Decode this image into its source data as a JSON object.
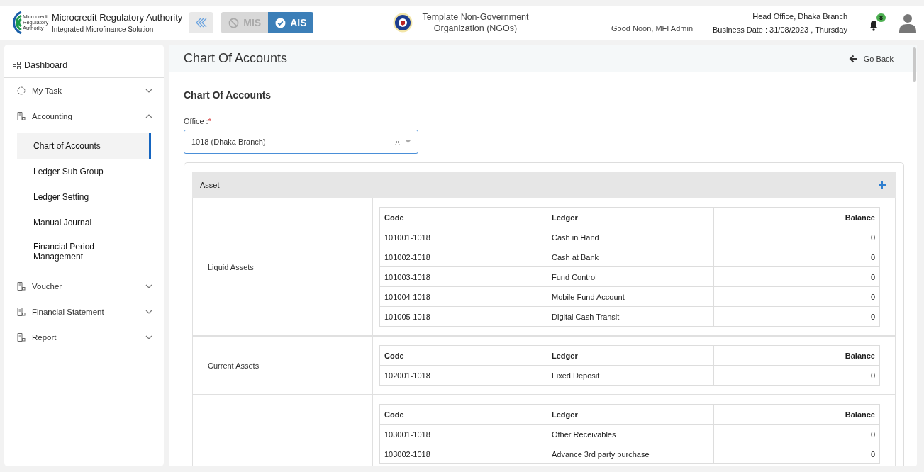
{
  "header": {
    "logo_text": "Microcredit Regulatory Authority",
    "org_name": "Microcredit Regulatory Authority",
    "org_subtitle": "Integrated Microfinance Solution",
    "modules": [
      {
        "label": "MIS",
        "selected": false
      },
      {
        "label": "AIS",
        "selected": true
      }
    ],
    "ngo_name": "Template Non-Government Organization (NGOs)",
    "greeting": "Good Noon, MFI Admin",
    "office": "Head Office, Dhaka Branch",
    "business_date": "Business Date : 31/08/2023 , Thursday",
    "notification_count": "8"
  },
  "sidebar": {
    "items": [
      {
        "label": "Dashboard",
        "kind": "dashboard"
      },
      {
        "label": "My Task",
        "kind": "task",
        "expanded": false
      },
      {
        "label": "Accounting",
        "kind": "module",
        "expanded": true,
        "children": [
          {
            "label": "Chart of Accounts",
            "selected": true
          },
          {
            "label": "Ledger Sub Group",
            "selected": false
          },
          {
            "label": "Ledger Setting",
            "selected": false
          },
          {
            "label": "Manual Journal",
            "selected": false
          },
          {
            "label": "Financial Period Management",
            "selected": false
          }
        ]
      },
      {
        "label": "Voucher",
        "kind": "module",
        "expanded": false
      },
      {
        "label": "Financial Statement",
        "kind": "module",
        "expanded": false
      },
      {
        "label": "Report",
        "kind": "module",
        "expanded": false
      }
    ]
  },
  "page": {
    "title": "Chart Of Accounts",
    "go_back": "Go Back",
    "form_title": "Chart Of Accounts",
    "office_field": {
      "label": "Office :",
      "required_mark": "*",
      "value": "1018 (Dhaka Branch)"
    },
    "sections": [
      {
        "title": "Asset",
        "groups": [
          {
            "name": "Liquid Assets",
            "columns": [
              "Code",
              "Ledger",
              "Balance"
            ],
            "rows": [
              [
                "101001-1018",
                "Cash in Hand",
                "0"
              ],
              [
                "101002-1018",
                "Cash at Bank",
                "0"
              ],
              [
                "101003-1018",
                "Fund Control",
                "0"
              ],
              [
                "101004-1018",
                "Mobile Fund Account",
                "0"
              ],
              [
                "101005-1018",
                "Digital Cash Transit",
                "0"
              ]
            ]
          },
          {
            "name": "Current Assets",
            "columns": [
              "Code",
              "Ledger",
              "Balance"
            ],
            "rows": [
              [
                "102001-1018",
                "Fixed Deposit",
                "0"
              ]
            ]
          },
          {
            "columns": [
              "Code",
              "Ledger",
              "Balance"
            ],
            "rows": [
              [
                "103001-1018",
                "Other Receivables",
                "0"
              ],
              [
                "103002-1018",
                "Advance 3rd party purchase",
                "0"
              ]
            ]
          }
        ]
      }
    ]
  }
}
